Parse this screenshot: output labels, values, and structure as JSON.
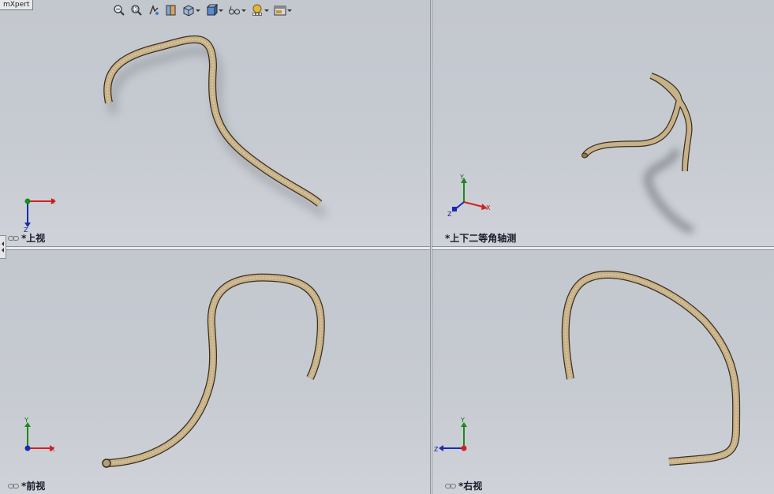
{
  "app": {
    "tab_label": "mXpert"
  },
  "toolbar": {
    "icons": [
      "zoom-to-fit",
      "zoom-to-area",
      "previous-view",
      "section-view",
      "view-orientation",
      "display-style",
      "hide-show-items",
      "edit-appearance",
      "apply-scene"
    ]
  },
  "viewports": {
    "top": {
      "label": "*上视"
    },
    "isometric": {
      "label": "*上下二等角轴测"
    },
    "front": {
      "label": "*前视"
    },
    "right": {
      "label": "*右视"
    }
  },
  "axes": {
    "x": "X",
    "y": "Y",
    "z": "Z"
  },
  "colors": {
    "viewport_bg": "#c6cad1",
    "splitter": "#e9ecf0",
    "tube": "#c8b28a",
    "tube_edge": "#5a4a30",
    "axis_x": "#d42020",
    "axis_y": "#1a8a1a",
    "axis_z": "#1a2ab0"
  }
}
